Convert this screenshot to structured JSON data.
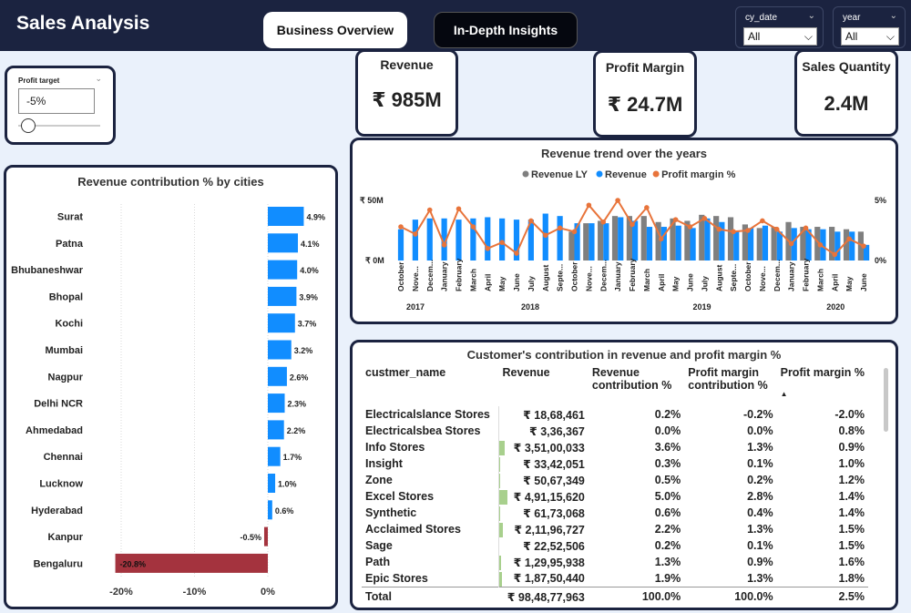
{
  "header": {
    "title": "Sales Analysis",
    "tabs": [
      {
        "label": "Business Overview"
      },
      {
        "label": "In-Depth Insights"
      }
    ],
    "filters": [
      {
        "label": "cy_date",
        "value": "All"
      },
      {
        "label": "year",
        "value": "All"
      }
    ]
  },
  "profit_target": {
    "label": "Profit target",
    "value": "-5%"
  },
  "kpis": [
    {
      "title": "Revenue",
      "value": "₹ 985M"
    },
    {
      "title": "Profit Margin",
      "value": "₹ 24.7M"
    },
    {
      "title": "Sales Quantity",
      "value": "2.4M"
    }
  ],
  "city_chart": {
    "title": "Revenue contribution % by cities",
    "colors": {
      "positive": "#118dff",
      "negative": "#a4333e"
    }
  },
  "trend_chart": {
    "title": "Revenue trend over the years",
    "legend": [
      {
        "name": "Revenue LY",
        "color": "#7f7f7f"
      },
      {
        "name": "Revenue",
        "color": "#118dff"
      },
      {
        "name": "Profit margin %",
        "color": "#e8743b"
      }
    ],
    "y_left_ticks": [
      "₹ 50M",
      "₹ 0M"
    ],
    "y_right_ticks": [
      "5%",
      "0%"
    ]
  },
  "chart_data": [
    {
      "type": "bar",
      "title": "Revenue contribution % by cities",
      "categories": [
        "Surat",
        "Patna",
        "Bhubaneshwar",
        "Bhopal",
        "Kochi",
        "Mumbai",
        "Nagpur",
        "Delhi NCR",
        "Ahmedabad",
        "Chennai",
        "Lucknow",
        "Hyderabad",
        "Kanpur",
        "Bengaluru"
      ],
      "values": [
        4.9,
        4.1,
        4.0,
        3.9,
        3.7,
        3.2,
        2.6,
        2.3,
        2.2,
        1.7,
        1.0,
        0.6,
        -0.5,
        -20.8
      ],
      "labels": [
        "4.9%",
        "4.1%",
        "4.0%",
        "3.9%",
        "3.7%",
        "3.2%",
        "2.6%",
        "2.3%",
        "2.2%",
        "1.7%",
        "1.0%",
        "0.6%",
        "-0.5%",
        "-20.8%"
      ],
      "xlim": [
        -22,
        6
      ],
      "xticks": [
        "-20%",
        "-10%",
        "0%"
      ],
      "orientation": "horizontal",
      "grid": true
    },
    {
      "type": "bar",
      "title": "Revenue trend over the years",
      "categories": [
        "October",
        "Nove...",
        "Decem...",
        "January",
        "February",
        "March",
        "April",
        "May",
        "June",
        "July",
        "August",
        "Septe...",
        "October",
        "Nove...",
        "Decem...",
        "January",
        "February",
        "March",
        "April",
        "May",
        "June",
        "July",
        "August",
        "Septe...",
        "October",
        "Nove...",
        "Decem...",
        "January",
        "February",
        "March",
        "April",
        "May",
        "June"
      ],
      "month_ticks_shown": [
        "October",
        "Nove...",
        "Decem...",
        "January",
        "February",
        "March",
        "April",
        "May",
        "June",
        "July",
        "August",
        "Septe...",
        "October",
        "Nove...",
        "Decem...",
        "January",
        "February",
        "March",
        "April",
        "May",
        "June",
        "July",
        "August",
        "Septe...",
        "October",
        "Nove...",
        "Decem...",
        "January",
        "February",
        "March",
        "April",
        "May",
        "June"
      ],
      "years": [
        {
          "label": "2017"
        },
        {
          "label": "2018"
        },
        {
          "label": "2019"
        },
        {
          "label": "2020"
        }
      ],
      "ylim": [
        0,
        50
      ],
      "y2lim": [
        0,
        5
      ],
      "series": [
        {
          "name": "Revenue LY",
          "values": [
            0,
            0,
            0,
            0,
            0,
            0,
            0,
            0,
            0,
            0,
            0,
            0,
            24,
            31,
            33,
            37,
            37,
            37,
            32,
            35,
            33,
            38,
            37,
            36,
            30,
            27,
            28,
            32,
            28,
            28,
            28,
            26,
            24
          ]
        },
        {
          "name": "Revenue",
          "values": [
            26,
            34,
            35,
            35,
            34,
            35,
            36,
            35,
            34,
            34,
            39,
            37,
            31,
            31,
            31,
            36,
            33,
            28,
            28,
            29,
            27,
            35,
            32,
            24,
            27,
            29,
            24,
            27,
            26,
            26,
            24,
            24,
            13
          ]
        },
        {
          "name": "Profit margin %",
          "values": [
            2.8,
            2.2,
            4.2,
            1.3,
            4.3,
            2.8,
            1.0,
            1.5,
            0.6,
            3.3,
            2.1,
            2.7,
            2.4,
            4.6,
            3.2,
            5.0,
            3.0,
            4.4,
            1.8,
            3.4,
            2.8,
            3.5,
            2.6,
            2.4,
            2.5,
            3.3,
            2.6,
            1.4,
            2.7,
            1.3,
            0.5,
            1.8,
            1.2
          ]
        }
      ]
    },
    {
      "type": "table",
      "title": "Customer's contribution in revenue and profit margin %",
      "columns": [
        "custmer_name",
        "Revenue",
        "Revenue contribution %",
        "Profit margin contribution %",
        "Profit margin %"
      ],
      "rows": [
        [
          "Electricalslance Stores",
          "₹ 18,68,461",
          "0.2%",
          "-0.2%",
          "-2.0%"
        ],
        [
          "Electricalsbea Stores",
          "₹ 3,36,367",
          "0.0%",
          "0.0%",
          "0.8%"
        ],
        [
          "Info Stores",
          "₹ 3,51,00,033",
          "3.6%",
          "1.3%",
          "0.9%"
        ],
        [
          "Insight",
          "₹ 33,42,051",
          "0.3%",
          "0.1%",
          "1.0%"
        ],
        [
          "Zone",
          "₹ 50,67,349",
          "0.5%",
          "0.2%",
          "1.2%"
        ],
        [
          "Excel Stores",
          "₹ 4,91,15,620",
          "5.0%",
          "2.8%",
          "1.4%"
        ],
        [
          "Synthetic",
          "₹ 61,73,068",
          "0.6%",
          "0.4%",
          "1.4%"
        ],
        [
          "Acclaimed Stores",
          "₹ 2,11,96,727",
          "2.2%",
          "1.3%",
          "1.5%"
        ],
        [
          "Sage",
          "₹ 22,52,506",
          "0.2%",
          "0.1%",
          "1.5%"
        ],
        [
          "Path",
          "₹ 1,29,95,938",
          "1.3%",
          "0.9%",
          "1.6%"
        ],
        [
          "Epic Stores",
          "₹ 1,87,50,440",
          "1.9%",
          "1.3%",
          "1.8%"
        ]
      ],
      "revenue_fraction": [
        0.004,
        0.001,
        0.07,
        0.007,
        0.01,
        0.1,
        0.012,
        0.043,
        0.005,
        0.026,
        0.038
      ],
      "total": [
        "Total",
        "₹ 98,48,77,963",
        "100.0%",
        "100.0%",
        "2.5%"
      ]
    }
  ],
  "table_panel": {
    "title": "Customer's contribution in revenue and profit margin %",
    "headers": {
      "name": "custmer_name",
      "revenue": "Revenue",
      "rev_contrib": "Revenue contribution %",
      "pm_contrib": "Profit margin contribution %",
      "pm_pct": "Profit margin %"
    },
    "data_bar_color": "#a8d08d"
  }
}
